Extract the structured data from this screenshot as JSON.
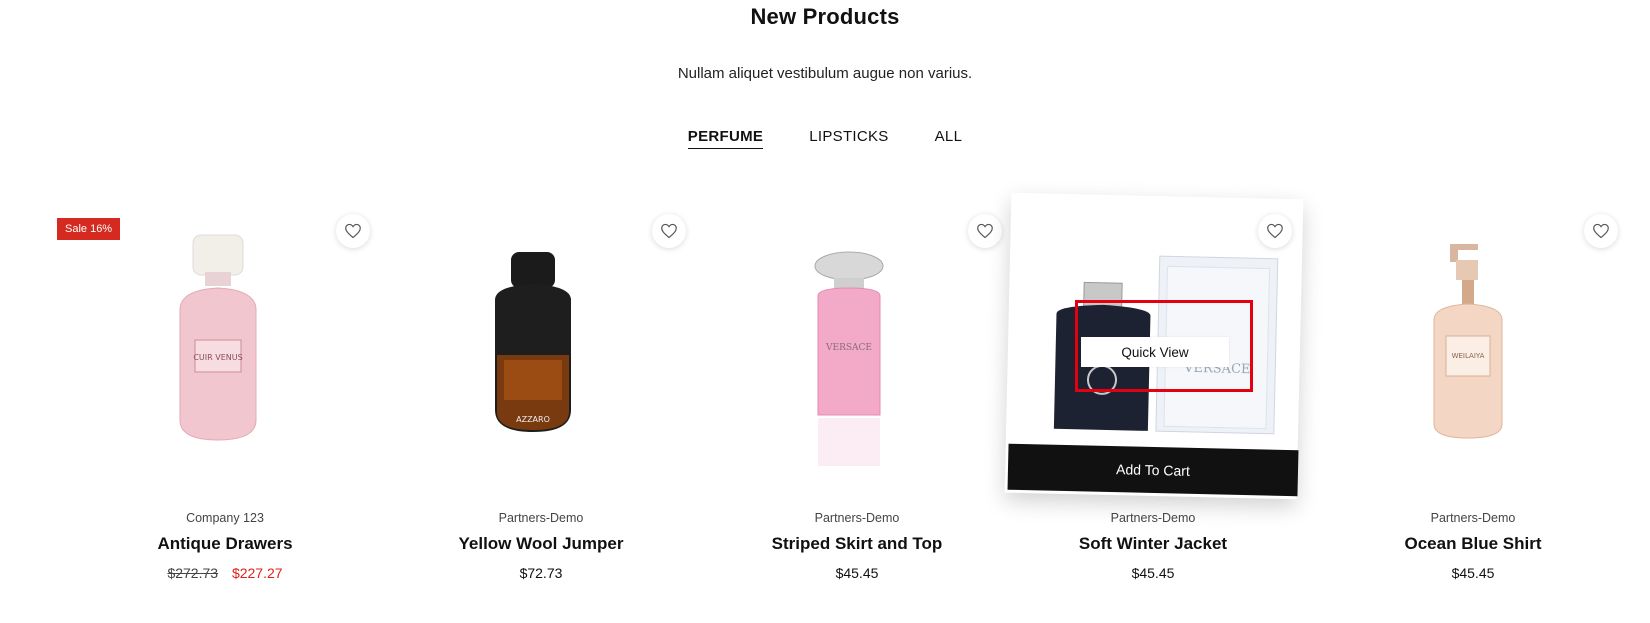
{
  "section": {
    "title": "New Products",
    "subtitle": "Nullam aliquet vestibulum augue non varius."
  },
  "tabs": [
    {
      "label": "PERFUME",
      "active": true
    },
    {
      "label": "LIPSTICKS",
      "active": false
    },
    {
      "label": "ALL",
      "active": false
    }
  ],
  "products": [
    {
      "brand": "Company 123",
      "name": "Antique Drawers",
      "price_old": "$272.73",
      "price": "$227.27",
      "badge": "Sale 16%",
      "image": "pink-perfume-bottle",
      "bottle_label": "CUIR VENUS"
    },
    {
      "brand": "Partners-Demo",
      "name": "Yellow Wool Jumper",
      "price": "$72.73",
      "image": "black-amber-perfume-bottle",
      "bottle_label": "AZZARO"
    },
    {
      "brand": "Partners-Demo",
      "name": "Striped Skirt and Top",
      "price": "$45.45",
      "image": "pink-versace-bottle",
      "bottle_label": "VERSACE"
    },
    {
      "brand": "Partners-Demo",
      "name": "Soft Winter Jacket",
      "price": "$45.45",
      "image": "navy-versace-bottle-with-box",
      "bottle_label": "VERSACE"
    },
    {
      "brand": "Partners-Demo",
      "name": "Ocean Blue Shirt",
      "price": "$45.45",
      "image": "pump-bottle",
      "bottle_label": "WEILAIYA"
    }
  ],
  "hover": {
    "quick_view_label": "Quick View",
    "add_to_cart_label": "Add To Cart"
  },
  "colors": {
    "sale": "#d42a20",
    "sale_price": "#e0201b",
    "highlight": "#e3000f",
    "cart_button": "#111111"
  }
}
